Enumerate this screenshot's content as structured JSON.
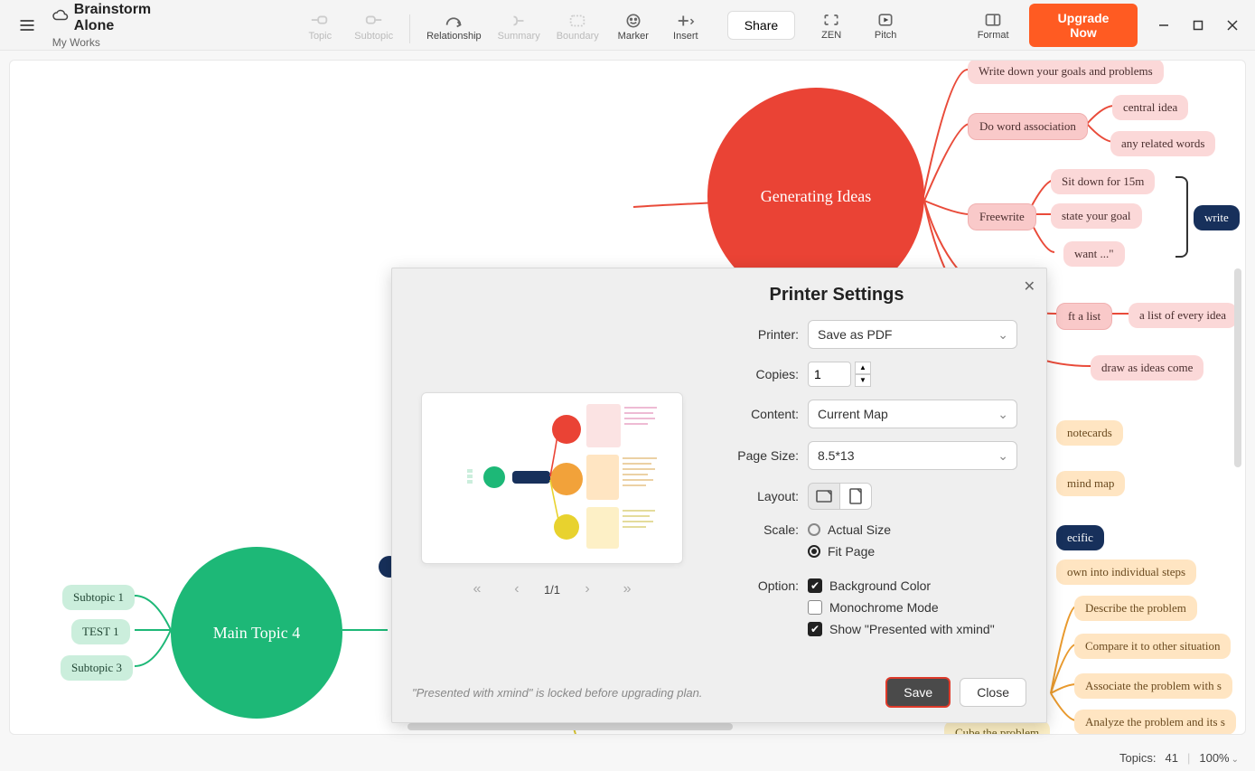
{
  "header": {
    "title": "Brainstorm Alone",
    "subtitle": "My Works"
  },
  "toolbar": {
    "topic": "Topic",
    "subtopic": "Subtopic",
    "relationship": "Relationship",
    "summary": "Summary",
    "boundary": "Boundary",
    "marker": "Marker",
    "insert": "Insert",
    "share": "Share",
    "zen": "ZEN",
    "pitch": "Pitch",
    "format": "Format",
    "upgrade": "Upgrade Now"
  },
  "mindmap": {
    "main_topic_4": "Main Topic 4",
    "subtopic1": "Subtopic 1",
    "test1": "TEST 1",
    "subtopic3": "Subtopic 3",
    "generating": "Generating Ideas",
    "write_down": "Write down your goals and problems",
    "word_assoc": "Do word association",
    "central_idea": "central idea",
    "related_words": "any related words",
    "freewrite": "Freewrite",
    "sit_down": "Sit down for 15m",
    "state_goal": "state your goal",
    "want": "want ...\"",
    "write": "write",
    "ft_list": "ft a list",
    "list_every": "a list of every idea",
    "draw_ideas": "draw as ideas come",
    "notecards": "notecards",
    "mind_map": "mind map",
    "specific": "ecific",
    "individual": "own into individual steps",
    "describe": "Describe the problem",
    "compare": "Compare it to other situation",
    "associate": "Associate the problem with s",
    "analyze": "Analyze the problem and its s",
    "cube": "Cube the problem"
  },
  "dialog": {
    "title": "Printer Settings",
    "labels": {
      "printer": "Printer:",
      "copies": "Copies:",
      "content": "Content:",
      "page_size": "Page Size:",
      "layout": "Layout:",
      "scale": "Scale:",
      "option": "Option:"
    },
    "printer": "Save as PDF",
    "copies": "1",
    "content": "Current Map",
    "page_size": "8.5*13",
    "scale_actual": "Actual Size",
    "scale_fit": "Fit Page",
    "opt_bg": "Background Color",
    "opt_mono": "Monochrome Mode",
    "opt_presented": "Show \"Presented with xmind\"",
    "page_indicator": "1/1",
    "lock_note": "\"Presented with xmind\" is locked before upgrading plan.",
    "save": "Save",
    "close": "Close"
  },
  "status": {
    "topics_label": "Topics:",
    "topics_count": "41",
    "zoom": "100%"
  }
}
